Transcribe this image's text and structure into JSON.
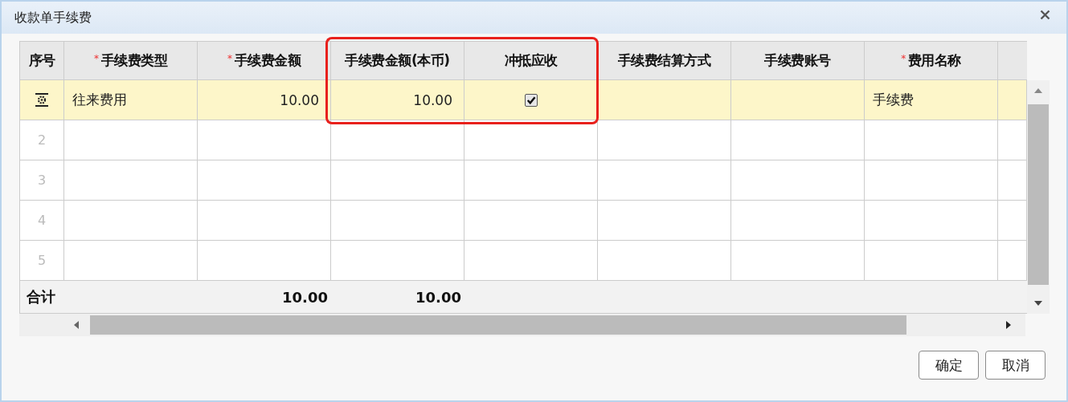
{
  "window": {
    "title": "收款单手续费"
  },
  "table": {
    "columns": [
      {
        "label": "序号",
        "highlighted": false
      },
      {
        "label": "手续费类型",
        "required_mark": "*",
        "highlighted": false
      },
      {
        "label": "手续费金额",
        "required_mark": "*",
        "highlighted": false
      },
      {
        "label": "手续费金额(本币)",
        "highlighted": true
      },
      {
        "label": "冲抵应收",
        "highlighted": true
      },
      {
        "label": "手续费结算方式",
        "highlighted": false
      },
      {
        "label": "手续费账号",
        "highlighted": false
      },
      {
        "label": "费用名称",
        "required_mark": "*",
        "highlighted": false
      }
    ],
    "rows": [
      {
        "kind": "current",
        "selected": true,
        "cells": [
          {
            "kind": "text",
            "text": "往来费用"
          },
          {
            "kind": "number",
            "text": "10.00"
          },
          {
            "kind": "number",
            "text": "10.00"
          },
          {
            "kind": "check",
            "checked": true
          },
          {
            "kind": "empty"
          },
          {
            "kind": "empty"
          },
          {
            "kind": "text",
            "text": "手续费"
          }
        ]
      },
      {
        "kind": "numbered",
        "selected": false,
        "number": "2"
      },
      {
        "kind": "numbered",
        "selected": false,
        "number": "3"
      },
      {
        "kind": "numbered",
        "selected": false,
        "number": "4"
      },
      {
        "kind": "numbered",
        "selected": false,
        "number": "5"
      }
    ],
    "totals": {
      "label": "合计",
      "cells": [
        {
          "kind": "empty"
        },
        {
          "kind": "number",
          "text": "10.00"
        },
        {
          "kind": "number",
          "text": "10.00"
        }
      ]
    }
  },
  "buttons": [
    {
      "label": "确定"
    },
    {
      "label": "取消"
    }
  ]
}
